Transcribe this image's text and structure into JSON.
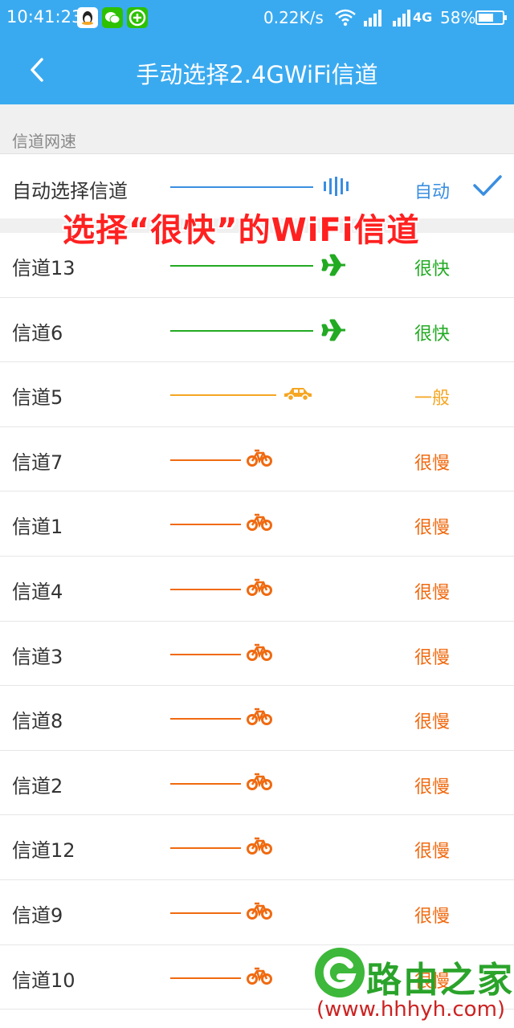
{
  "status_bar": {
    "time": "10:41:23",
    "net_speed": "0.22K/s",
    "network": "4G",
    "battery": "58%"
  },
  "header": {
    "title": "手动选择2.4GWiFi信道"
  },
  "section": {
    "label": "信道网速"
  },
  "auto_channel": {
    "label": "自动选择信道",
    "status": "自动",
    "selected": true
  },
  "annotation": "选择“很快”的WiFi信道",
  "channels": [
    {
      "label": "信道13",
      "status": "很快",
      "speed_icon": "airplane-icon"
    },
    {
      "label": "信道6",
      "status": "很快",
      "speed_icon": "airplane-icon"
    },
    {
      "label": "信道5",
      "status": "一般",
      "speed_icon": "car-icon"
    },
    {
      "label": "信道7",
      "status": "很慢",
      "speed_icon": "bicycle-icon"
    },
    {
      "label": "信道1",
      "status": "很慢",
      "speed_icon": "bicycle-icon"
    },
    {
      "label": "信道4",
      "status": "很慢",
      "speed_icon": "bicycle-icon"
    },
    {
      "label": "信道3",
      "status": "很慢",
      "speed_icon": "bicycle-icon"
    },
    {
      "label": "信道8",
      "status": "很慢",
      "speed_icon": "bicycle-icon"
    },
    {
      "label": "信道2",
      "status": "很慢",
      "speed_icon": "bicycle-icon"
    },
    {
      "label": "信道12",
      "status": "很慢",
      "speed_icon": "bicycle-icon"
    },
    {
      "label": "信道9",
      "status": "很慢",
      "speed_icon": "bicycle-icon"
    },
    {
      "label": "信道10",
      "status": "很慢",
      "speed_icon": "bicycle-icon"
    }
  ],
  "colors": {
    "header_bg": "#3aaaf0",
    "auto": "#3a8ee0",
    "fast": "#22aa22",
    "normal": "#f5a623",
    "slow": "#f06a10",
    "annotation": "#ff2020"
  },
  "watermark": {
    "brand": "路由之家",
    "url": "(www.hhhyh.com)"
  }
}
